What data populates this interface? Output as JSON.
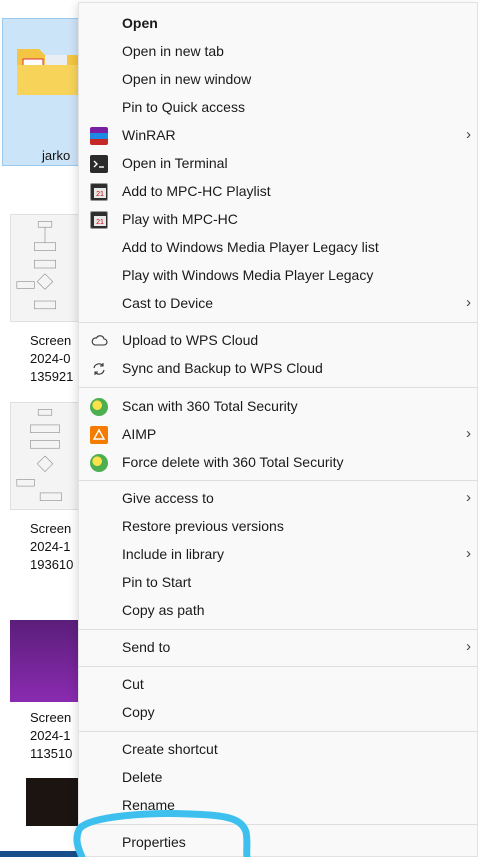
{
  "explorer": {
    "folder_name": "jarko",
    "files": [
      {
        "line1": "Screen",
        "line2": "2024-0",
        "line3": "135921"
      },
      {
        "line1": "Screen",
        "line2": "2024-1",
        "line3": "193610"
      },
      {
        "line1": "Screen",
        "line2": "2024-1",
        "line3": "113510"
      }
    ]
  },
  "menu": {
    "items": [
      {
        "label": "Open",
        "bold": true
      },
      {
        "label": "Open in new tab"
      },
      {
        "label": "Open in new window"
      },
      {
        "label": "Pin to Quick access"
      },
      {
        "label": "WinRAR",
        "icon": "winrar-icon",
        "submenu": true
      },
      {
        "label": "Open in Terminal",
        "icon": "terminal-icon"
      },
      {
        "label": "Add to MPC-HC Playlist",
        "icon": "mpc-hc-icon"
      },
      {
        "label": "Play with MPC-HC",
        "icon": "mpc-hc-icon"
      },
      {
        "label": "Add to Windows Media Player Legacy list"
      },
      {
        "label": "Play with Windows Media Player Legacy"
      },
      {
        "label": "Cast to Device",
        "submenu": true
      },
      {
        "label": "Upload to WPS Cloud",
        "icon": "cloud-icon"
      },
      {
        "label": "Sync and Backup to WPS Cloud",
        "icon": "sync-icon"
      },
      {
        "label": "Scan with 360 Total Security",
        "icon": "360-icon"
      },
      {
        "label": "AIMP",
        "icon": "aimp-icon",
        "submenu": true
      },
      {
        "label": "Force delete with 360 Total Security",
        "icon": "360-icon"
      },
      {
        "label": "Give access to",
        "submenu": true
      },
      {
        "label": "Restore previous versions"
      },
      {
        "label": "Include in library",
        "submenu": true
      },
      {
        "label": "Pin to Start"
      },
      {
        "label": "Copy as path"
      },
      {
        "label": "Send to",
        "submenu": true
      },
      {
        "label": "Cut"
      },
      {
        "label": "Copy"
      },
      {
        "label": "Create shortcut"
      },
      {
        "label": "Delete"
      },
      {
        "label": "Rename"
      },
      {
        "label": "Properties"
      }
    ],
    "chevron": "›"
  },
  "annotation_color": "#3ec0ef"
}
